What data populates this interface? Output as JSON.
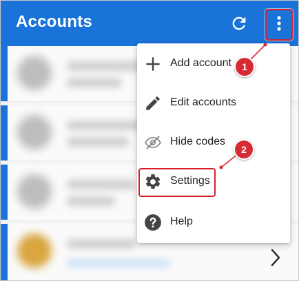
{
  "appbar": {
    "title": "Accounts",
    "bg_color": "#1a73d9",
    "refresh_icon": "refresh-icon",
    "more_icon": "more-vert-icon"
  },
  "accounts_list": {
    "rows": [
      {
        "icon": "blurred-avatar"
      },
      {
        "icon": "blurred-avatar"
      },
      {
        "icon": "blurred-avatar"
      },
      {
        "icon": "blurred-avatar"
      }
    ],
    "chevron_icon": "chevron-right-icon"
  },
  "menu": {
    "items": [
      {
        "label": "Add account",
        "icon": "plus-icon"
      },
      {
        "label": "Edit accounts",
        "icon": "pencil-icon"
      },
      {
        "label": "Hide codes",
        "icon": "eye-off-icon"
      },
      {
        "label": "Settings",
        "icon": "gear-icon"
      },
      {
        "label": "Help",
        "icon": "help-icon"
      }
    ]
  },
  "annotations": {
    "badge_1": "1",
    "badge_2": "2",
    "color": "#d62b34"
  }
}
